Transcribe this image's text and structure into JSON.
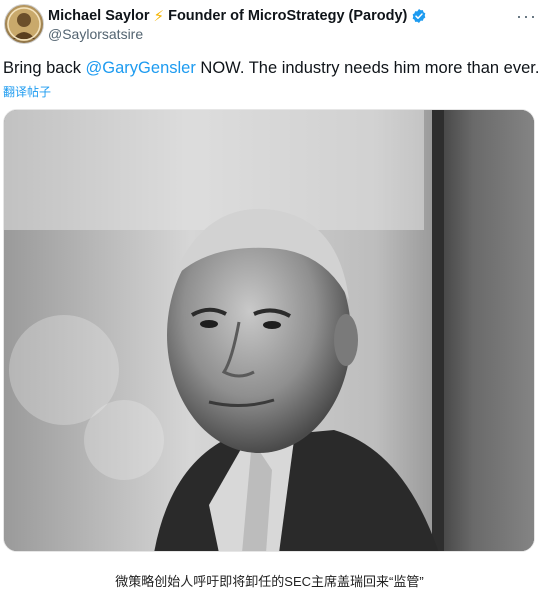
{
  "tweet": {
    "author_name": "Michael Saylor",
    "author_emoji": "⚡",
    "author_title": "Founder of MicroStrategy (Parody)",
    "handle": "@Saylorsatsire",
    "text_prefix": "Bring back ",
    "mention": "@GaryGensler",
    "text_suffix": " NOW. The industry needs him more than ever.",
    "translate_label": "翻译帖子",
    "more_icon_text": "···",
    "verified_color": "#1d9bf0"
  },
  "caption": "微策略创始人呼吁即将卸任的SEC主席盖瑞回来“监管”"
}
